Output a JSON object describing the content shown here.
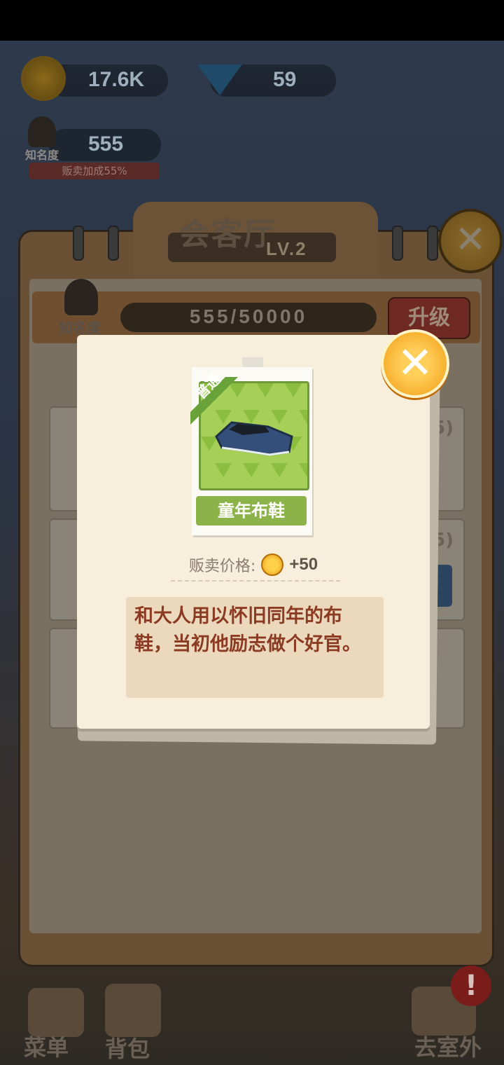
{
  "hud": {
    "coins": "17.6K",
    "diamonds": "59",
    "fame_label": "知名度",
    "fame_value": "555",
    "sale_bonus": "贩卖加成55%"
  },
  "hall": {
    "title": "会客厅",
    "level": "LV.2",
    "fame_label": "知名度",
    "fame_progress": "555/50000",
    "upgrade_label": "升级",
    "close_glyph": "✕",
    "list_hint_1": "5)",
    "list_hint_2": "5)"
  },
  "popup": {
    "close_glyph": "✕",
    "rarity": "普通",
    "item_name": "童年布鞋",
    "price_label": "贩卖价格:",
    "price_value": "+50",
    "description": "和大人用以怀旧同年的布鞋，当初他励志做个好官。"
  },
  "nav": {
    "menu_label": "菜单",
    "bag_label": "背包",
    "outdoor_label": "去室外",
    "alert_glyph": "!"
  },
  "icons": {
    "coin": "coin-icon",
    "diamond": "diamond-icon",
    "avatar": "avatar-icon",
    "close": "close-icon",
    "item": "cloth-shoe-icon"
  },
  "colors": {
    "popup_bg": "#f7eedb",
    "close_button": "#f29b12",
    "name_plate": "#8cb34a",
    "description_text": "#8b3b22",
    "description_bg": "#ebd8bd"
  }
}
